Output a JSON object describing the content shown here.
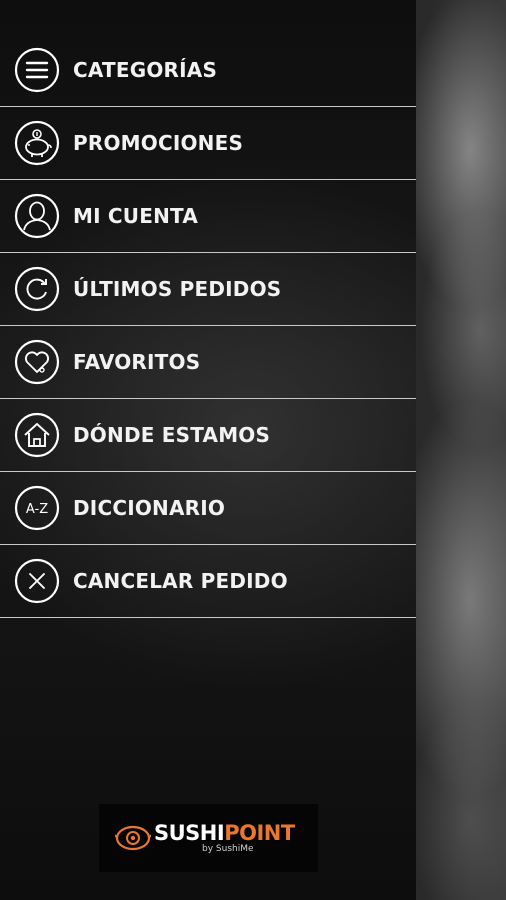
{
  "menu": {
    "items": [
      {
        "label": "CATEGORÍAS",
        "icon": "hamburger-icon"
      },
      {
        "label": "PROMOCIONES",
        "icon": "piggy-bank-icon"
      },
      {
        "label": "MI CUENTA",
        "icon": "user-icon"
      },
      {
        "label": "ÚLTIMOS PEDIDOS",
        "icon": "refresh-icon"
      },
      {
        "label": "FAVORITOS",
        "icon": "heart-icon"
      },
      {
        "label": "DÓNDE ESTAMOS",
        "icon": "home-icon"
      },
      {
        "label": "DICCIONARIO",
        "icon": "dictionary-icon"
      },
      {
        "label": "CANCELAR PEDIDO",
        "icon": "close-icon"
      }
    ]
  },
  "logo": {
    "brand_part1": "SUSHI",
    "brand_part2": "POINT",
    "tagline": "by SushiMe",
    "icon": "sushi-logo-icon"
  },
  "dictionary_icon_text": "A-Z",
  "colors": {
    "drawer_background": "#141414",
    "divider": "#c9c9c9",
    "text": "#f2f2f2",
    "brand_accent": "#e9772f"
  }
}
